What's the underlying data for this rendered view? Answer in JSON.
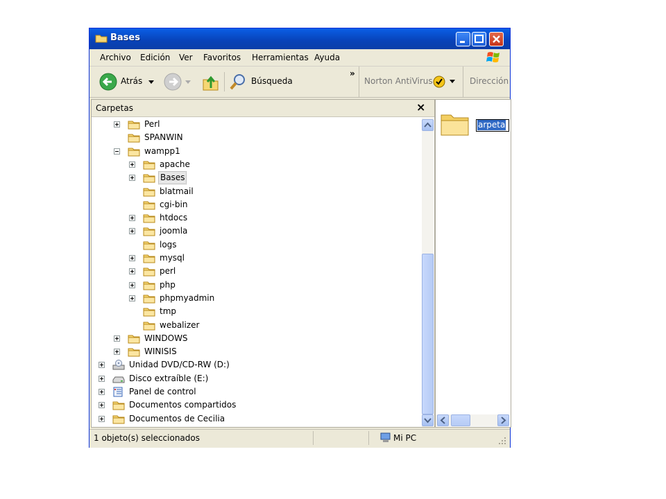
{
  "window": {
    "title": "Bases"
  },
  "menu": [
    "Archivo",
    "Edición",
    "Ver",
    "Favoritos",
    "Herramientas",
    "Ayuda"
  ],
  "toolbar": {
    "back_label": "Atrás",
    "search_label": "Búsqueda",
    "chevron": "»",
    "norton_label": "Norton AntiVirus",
    "address_label": "Dirección"
  },
  "folders_pane": {
    "header": "Carpetas",
    "close_glyph": "×"
  },
  "tree": [
    {
      "label": "Perl",
      "level": 2,
      "expander": "plus",
      "icon": "folder-icon"
    },
    {
      "label": "SPANWIN",
      "level": 2,
      "expander": "none",
      "icon": "folder-icon"
    },
    {
      "label": "wampp1",
      "level": 2,
      "expander": "minus",
      "icon": "folder-icon"
    },
    {
      "label": "apache",
      "level": 3,
      "expander": "plus",
      "icon": "folder-icon"
    },
    {
      "label": "Bases",
      "level": 3,
      "expander": "plus",
      "icon": "folder-icon",
      "selected": true
    },
    {
      "label": "blatmail",
      "level": 3,
      "expander": "none",
      "icon": "folder-icon"
    },
    {
      "label": "cgi-bin",
      "level": 3,
      "expander": "none",
      "icon": "folder-icon"
    },
    {
      "label": "htdocs",
      "level": 3,
      "expander": "plus",
      "icon": "folder-icon"
    },
    {
      "label": "joomla",
      "level": 3,
      "expander": "plus",
      "icon": "folder-icon"
    },
    {
      "label": "logs",
      "level": 3,
      "expander": "none",
      "icon": "folder-icon"
    },
    {
      "label": "mysql",
      "level": 3,
      "expander": "plus",
      "icon": "folder-icon"
    },
    {
      "label": "perl",
      "level": 3,
      "expander": "plus",
      "icon": "folder-icon"
    },
    {
      "label": "php",
      "level": 3,
      "expander": "plus",
      "icon": "folder-icon"
    },
    {
      "label": "phpmyadmin",
      "level": 3,
      "expander": "plus",
      "icon": "folder-icon"
    },
    {
      "label": "tmp",
      "level": 3,
      "expander": "none",
      "icon": "folder-icon"
    },
    {
      "label": "webalizer",
      "level": 3,
      "expander": "none",
      "icon": "folder-icon"
    },
    {
      "label": "WINDOWS",
      "level": 2,
      "expander": "plus",
      "icon": "folder-icon"
    },
    {
      "label": "WINISIS",
      "level": 2,
      "expander": "plus",
      "icon": "folder-icon"
    },
    {
      "label": "Unidad DVD/CD-RW (D:)",
      "level": 1,
      "expander": "plus",
      "icon": "cd-drive-icon"
    },
    {
      "label": "Disco extraíble (E:)",
      "level": 1,
      "expander": "plus",
      "icon": "removable-disk-icon"
    },
    {
      "label": "Panel de control",
      "level": 1,
      "expander": "plus",
      "icon": "control-panel-icon"
    },
    {
      "label": "Documentos compartidos",
      "level": 1,
      "expander": "plus",
      "icon": "folder-icon"
    },
    {
      "label": "Documentos de Cecilia",
      "level": 1,
      "expander": "plus",
      "icon": "folder-icon"
    }
  ],
  "content": {
    "item_name_edit": "arpeta"
  },
  "status": {
    "selection": "1 objeto(s) seleccionados",
    "location": "Mi PC"
  },
  "colors": {
    "titlebar": "#0a5fe6",
    "selection": "#316ac5"
  }
}
